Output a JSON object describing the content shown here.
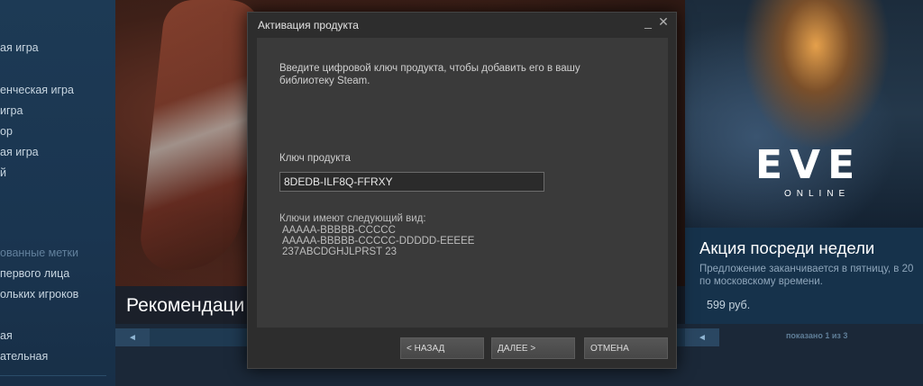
{
  "sidebar": {
    "items": [
      {
        "label": "ая игра"
      },
      {
        "label": "енческая игра"
      },
      {
        "label": "игра"
      },
      {
        "label": "ор"
      },
      {
        "label": "ая игра"
      },
      {
        "label": "й"
      },
      {
        "label": "ованные метки"
      },
      {
        "label": "первого лица"
      },
      {
        "label": "ольких игроков"
      },
      {
        "label": "ая"
      },
      {
        "label": "ательная"
      }
    ]
  },
  "hero": {
    "title": "Рекомендаци"
  },
  "carousel": {
    "prev_icon": "◄",
    "counter": "показано 1 из 3"
  },
  "promo": {
    "logo": "EVE",
    "logo_sub": "ONLINE",
    "title": "Акция посреди недели",
    "desc_line1": "Предложение заканчивается в пятницу, в 20",
    "desc_line2": "по московскому времени.",
    "price": "599 руб."
  },
  "modal": {
    "title": "Активация продукта",
    "minimize_icon": "_",
    "close_icon": "✕",
    "intro": "Введите цифровой ключ продукта, чтобы добавить его в вашу библиотеку Steam.",
    "key_label": "Ключ продукта",
    "key_value": "8DEDB-ILF8Q-FFRXY",
    "formats_title": "Ключи имеют следующий вид:",
    "formats": [
      "AAAAA-BBBBB-CCCCC",
      "AAAAA-BBBBB-CCCCC-DDDDD-EEEEE",
      "237ABCDGHJLPRST 23"
    ],
    "back_label": "< НАЗАД",
    "next_label": "ДАЛЕЕ >",
    "cancel_label": "ОТМЕНА"
  }
}
